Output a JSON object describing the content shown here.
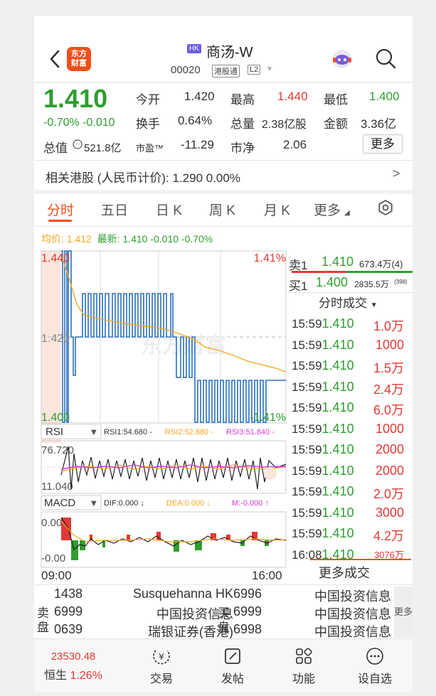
{
  "header": {
    "market_badge": "HK",
    "stock_name": "商汤-W",
    "stock_code": "00020",
    "tag_connect": "港股通",
    "tag_level": "L2",
    "logo_text_1": "东方",
    "logo_text_2": "财富"
  },
  "quote": {
    "price": "1.410",
    "change": "-0.70% -0.010",
    "open_label": "今开",
    "open": "1.420",
    "high_label": "最高",
    "high": "1.440",
    "low_label": "最低",
    "low": "1.400",
    "turnover_label": "换手",
    "turnover": "0.64%",
    "volume_label": "总量",
    "volume": "2.38亿股",
    "amount_label": "金额",
    "amount": "3.36亿",
    "total_value_label": "总值",
    "total_value": "521.8亿",
    "pe_label": "市盈™",
    "pe": "-11.29",
    "pb_label": "市净",
    "pb": "2.06",
    "more_label": "更多"
  },
  "related": {
    "text": "相关港股 (人民币计价):  1.290  0.00%"
  },
  "tabs": [
    "分时",
    "五日",
    "日 K",
    "周 K",
    "月 K",
    "更多"
  ],
  "chart": {
    "avg_label": "均价:",
    "avg": "1.412",
    "latest_label": "最新:",
    "latest": "1.410 -0.010 -0.70%",
    "y_top": "1.440",
    "y_mid": "1.420",
    "y_bot": "1.400",
    "pct_top": "1.41%",
    "pct_bot": "-1.41%",
    "time_start": "09:00",
    "time_end": "16:00",
    "rsi_label": "RSI",
    "rsi1": "RSI1:54.680 -",
    "rsi2": "RSI2:52.880 -",
    "rsi3": "RSI3:51.840 -",
    "rsi_top": "76.720",
    "rsi_bot": "11.040",
    "macd_label": "MACD",
    "dif": "DIF:0.000 ↓",
    "dea": "DEA:0.000 ↓",
    "m": "M:-0.000 ↑",
    "macd_top": "0.005",
    "macd_bot": "-0.00"
  },
  "order_book": {
    "sell_label": "卖1",
    "sell_price": "1.410",
    "sell_vol": "673.4万(4)",
    "buy_label": "买1",
    "buy_price": "1.400",
    "buy_vol": "2835.5万",
    "buy_count": "(398)"
  },
  "trades": {
    "title": "分时成交",
    "rows": [
      {
        "time": "15:59",
        "price": "1.410",
        "vol": "1.0万"
      },
      {
        "time": "15:59",
        "price": "1.410",
        "vol": "1000"
      },
      {
        "time": "15:59",
        "price": "1.410",
        "vol": "1.5万"
      },
      {
        "time": "15:59",
        "price": "1.410",
        "vol": "2.4万"
      },
      {
        "time": "15:59",
        "price": "1.410",
        "vol": "6.0万"
      },
      {
        "time": "15:59",
        "price": "1.410",
        "vol": "1000"
      },
      {
        "time": "15:59",
        "price": "1.410",
        "vol": "2000"
      },
      {
        "time": "15:59",
        "price": "1.410",
        "vol": "2000"
      },
      {
        "time": "15:59",
        "price": "1.410",
        "vol": "2.0万"
      },
      {
        "time": "15:59",
        "price": "1.410",
        "vol": "3000"
      },
      {
        "time": "15:59",
        "price": "1.410",
        "vol": "4.2万"
      },
      {
        "time": "16:08",
        "price": "1.410",
        "vol": "3076万"
      }
    ],
    "more_label": "更多成交"
  },
  "brokers": {
    "sell_side": "卖盘",
    "buy_side": "买盘",
    "more": "更多",
    "sell": [
      {
        "code": "1438",
        "name": "Susquehanna HK"
      },
      {
        "code": "6999",
        "name": "中国投资信息"
      },
      {
        "code": "0639",
        "name": "瑞银证券(香港)"
      }
    ],
    "buy": [
      {
        "code": "6996",
        "name": "中国投资信息"
      },
      {
        "code": "6999",
        "name": "中国投资信息"
      },
      {
        "code": "6998",
        "name": "中国投资信息"
      }
    ]
  },
  "bottom_bar": {
    "index_value": "23530.48",
    "index_name": "恒生",
    "index_change": "1.26%",
    "trade_label": "交易",
    "post_label": "发帖",
    "func_label": "功能",
    "watch_label": "设自选"
  },
  "colors": {
    "up": "#e53935",
    "down": "#2e9e2e",
    "brand": "#f04f1b",
    "avg": "#f5a623",
    "price_line": "#2a6fbd"
  }
}
